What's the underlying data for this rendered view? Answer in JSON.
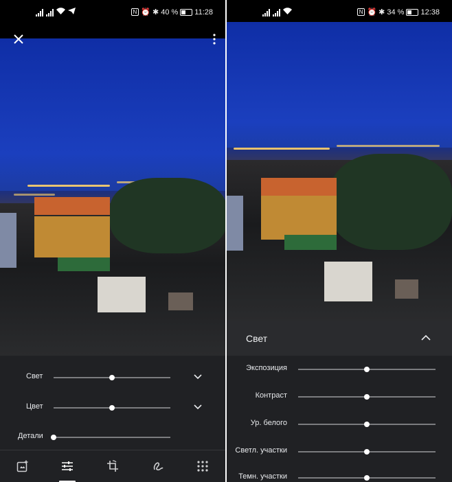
{
  "left_screen": {
    "status": {
      "battery": "40 %",
      "time": "11:28"
    },
    "controls": [
      {
        "label": "Свет",
        "value": 0.5,
        "expandable": true
      },
      {
        "label": "Цвет",
        "value": 0.5,
        "expandable": true
      },
      {
        "label": "Детали",
        "value": 0.0,
        "expandable": false
      }
    ],
    "toolbar": [
      "add-photo-icon",
      "tune-icon",
      "crop-rotate-icon",
      "markup-icon",
      "grid-icon"
    ],
    "active_tool": "tune-icon"
  },
  "right_screen": {
    "status": {
      "battery": "34 %",
      "time": "12:38"
    },
    "section_title": "Свет",
    "controls": [
      {
        "label": "Экспозиция",
        "value": 0.5
      },
      {
        "label": "Контраст",
        "value": 0.5
      },
      {
        "label": "Ур. белого",
        "value": 0.5
      },
      {
        "label": "Светл. участки",
        "value": 0.5
      },
      {
        "label": "Темн. участки",
        "value": 0.5
      }
    ]
  },
  "colors": {
    "panel": "#202124",
    "sky": "#1b3fbe",
    "slider": "#7b7c7f"
  }
}
